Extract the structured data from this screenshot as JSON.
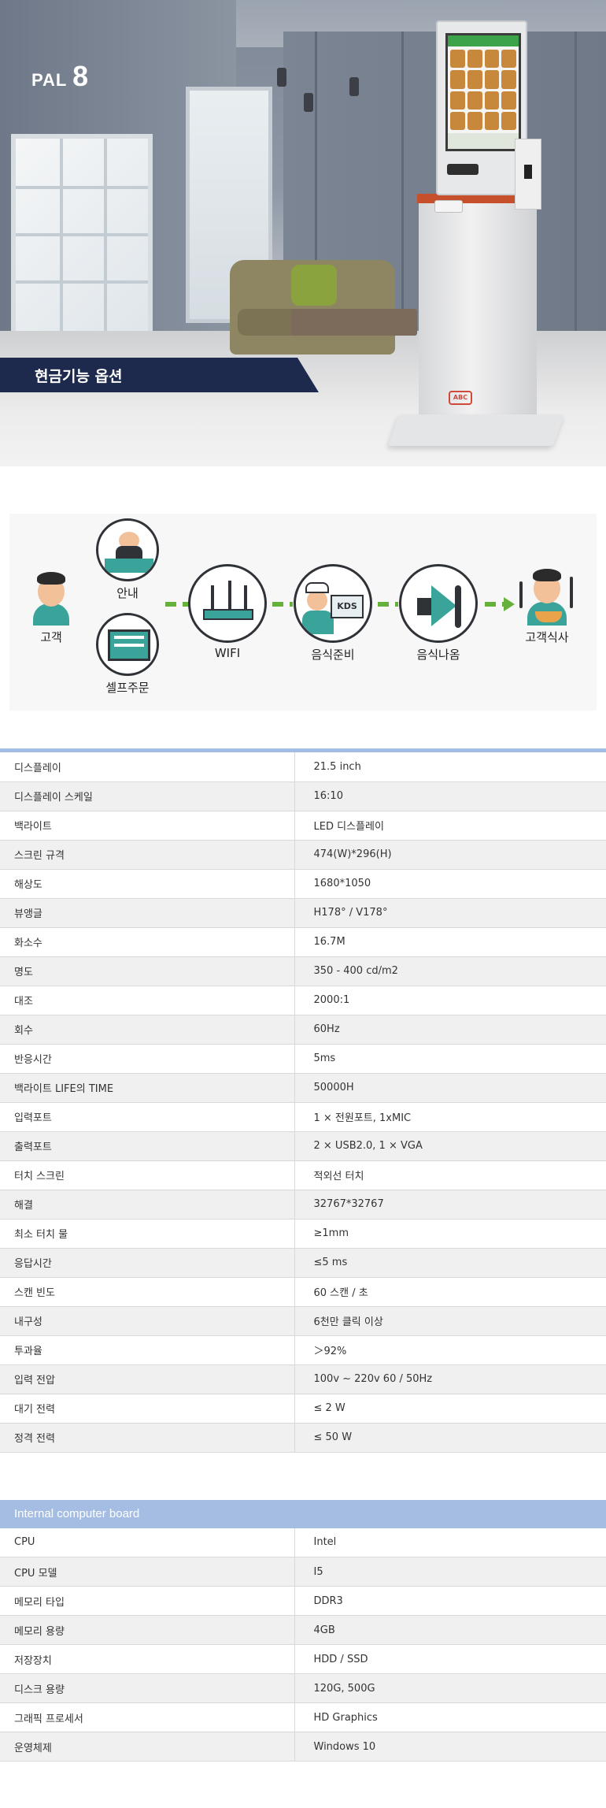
{
  "hero": {
    "sign_small": "PAL",
    "sign_big": "8",
    "banner_title": "현금기능 옵션",
    "kiosk_logo": "ABC"
  },
  "process": {
    "customer": "고객",
    "guide": "안내",
    "self_order": "셀프주문",
    "wifi": "WIFI",
    "food_prep": "음식준비",
    "food_out": "음식나옴",
    "customer_meal": "고객식사",
    "kds_label": "KDS"
  },
  "spec_rows": [
    {
      "k": "디스플레이",
      "v": "21.5 inch"
    },
    {
      "k": "디스플레이 스케일",
      "v": "16:10"
    },
    {
      "k": "백라이트",
      "v": "LED 디스플레이"
    },
    {
      "k": "스크린 규격",
      "v": "474(W)*296(H)"
    },
    {
      "k": "해상도",
      "v": "1680*1050"
    },
    {
      "k": "뷰앵글",
      "v": "H178° / V178°"
    },
    {
      "k": "화소수",
      "v": "16.7M"
    },
    {
      "k": "명도",
      "v": "350 - 400 cd/m2"
    },
    {
      "k": "대조",
      "v": "2000:1"
    },
    {
      "k": "회수",
      "v": "60Hz"
    },
    {
      "k": "반응시간",
      "v": "5ms"
    },
    {
      "k": "백라이트 LIFE의 TIME",
      "v": "50000H"
    },
    {
      "k": "입력포트",
      "v": "1 × 전원포트, 1xMIC"
    },
    {
      "k": "출력포트",
      "v": "2 × USB2.0, 1 × VGA"
    },
    {
      "k": "터치 스크린",
      "v": "적외선 터치"
    },
    {
      "k": "해결",
      "v": "32767*32767"
    },
    {
      "k": "최소 터치 물",
      "v": "≥1mm"
    },
    {
      "k": "응답시간",
      "v": "≤5 ms"
    },
    {
      "k": "스캔 빈도",
      "v": "60 스캔 / 초"
    },
    {
      "k": "내구성",
      "v": "6천만 클릭 이상"
    },
    {
      "k": "투과율",
      "v": "＞92%"
    },
    {
      "k": "입력 전압",
      "v": "100v ~ 220v 60 / 50Hz"
    },
    {
      "k": "대기 전력",
      "v": "≤ 2 W"
    },
    {
      "k": "정격 전력",
      "v": "≤ 50 W"
    }
  ],
  "board": {
    "title": "Internal computer board",
    "rows": [
      {
        "k": "CPU",
        "v": "Intel"
      },
      {
        "k": "CPU 모델",
        "v": "I5"
      },
      {
        "k": "메모리 타입",
        "v": "DDR3"
      },
      {
        "k": "메모리 용량",
        "v": "4GB"
      },
      {
        "k": "저장장치",
        "v": "HDD / SSD"
      },
      {
        "k": "디스크 용량",
        "v": "120G, 500G"
      },
      {
        "k": "그래픽 프로세서",
        "v": "HD Graphics"
      },
      {
        "k": "운영체제",
        "v": "Windows 10"
      }
    ]
  },
  "colors": {
    "banner": "#1d2a4e",
    "arrow": "#66b13b",
    "table_head": "#a6bde3"
  }
}
